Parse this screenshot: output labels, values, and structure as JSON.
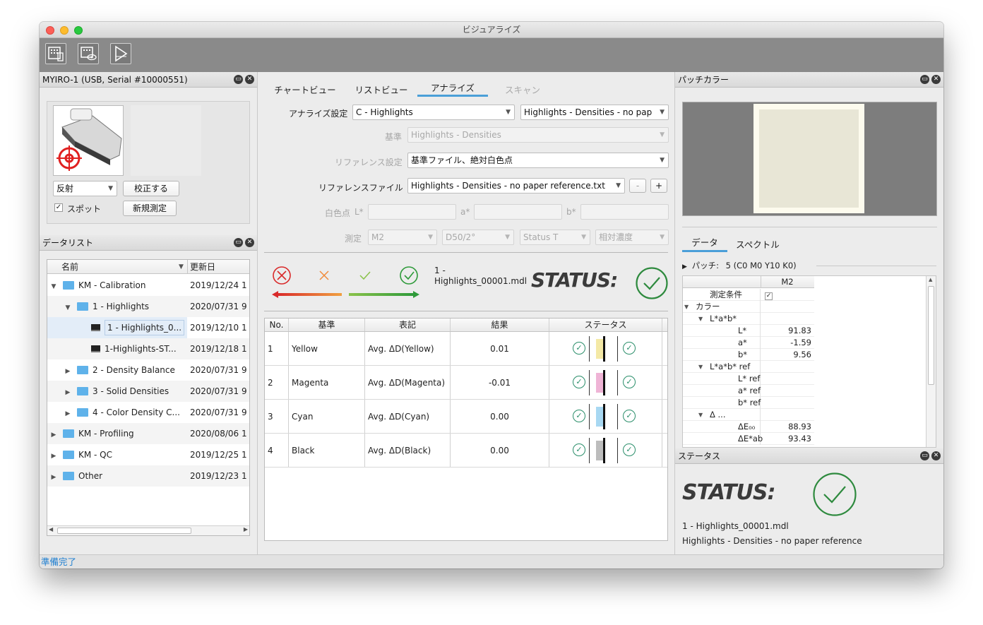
{
  "window": {
    "title": "ビジュアライズ"
  },
  "device_panel": {
    "title": "MYIRO-1 (USB, Serial #10000551)",
    "mode_select": "反射",
    "calibrate_button": "校正する",
    "spot_label": "スポット",
    "spot_checked": true,
    "new_measure_button": "新規測定"
  },
  "datalist": {
    "title": "データリスト",
    "columns": [
      "名前",
      "更新日"
    ],
    "rows": [
      {
        "name": "KM - Calibration",
        "date": "2019/12/24 1",
        "type": "folder",
        "expanded": true,
        "indent": 0
      },
      {
        "name": "1 - Highlights",
        "date": "2020/07/31 9",
        "type": "folder",
        "expanded": true,
        "indent": 1
      },
      {
        "name": "1 - Highlights_0...",
        "date": "2019/12/10 1",
        "type": "doc",
        "indent": 2,
        "selected": true
      },
      {
        "name": "1-Highlights-ST...",
        "date": "2019/12/18 1",
        "type": "doc",
        "indent": 2
      },
      {
        "name": "2 - Density Balance",
        "date": "2020/07/31 9",
        "type": "folder",
        "expanded": false,
        "indent": 1
      },
      {
        "name": "3 - Solid Densities",
        "date": "2020/07/31 9",
        "type": "folder",
        "expanded": false,
        "indent": 1
      },
      {
        "name": "4 - Color Density C...",
        "date": "2020/07/31 9",
        "type": "folder",
        "expanded": false,
        "indent": 1
      },
      {
        "name": "KM - Profiling",
        "date": "2020/08/06 1",
        "type": "folder",
        "expanded": false,
        "indent": 0
      },
      {
        "name": "KM - QC",
        "date": "2019/12/25 1",
        "type": "folder",
        "expanded": false,
        "indent": 0
      },
      {
        "name": "Other",
        "date": "2019/12/23 1",
        "type": "folder",
        "expanded": false,
        "indent": 0
      }
    ]
  },
  "center": {
    "tabs": [
      "チャートビュー",
      "リストビュー",
      "アナライズ",
      "スキャン"
    ],
    "active_tab": "アナライズ",
    "analyze_label": "アナライズ設定",
    "analyze_value": "C - Highlights",
    "analyze_value2": "Highlights - Densities - no pap",
    "criteria_label": "基準",
    "criteria_value": "Highlights - Densities",
    "reference_label": "リファレンス設定",
    "reference_value": "基準ファイル、絶対白色点",
    "reffile_label": "リファレンスファイル",
    "reffile_value": "Highlights - Densities - no paper reference.txt",
    "minus": "-",
    "plus": "+",
    "whitepoint_label": "白色点",
    "L_label": "L*",
    "a_label": "a*",
    "b_label": "b*",
    "measure_label": "測定",
    "measure_m": "M2",
    "measure_d": "D50/2°",
    "measure_status": "Status T",
    "measure_density": "相対濃度",
    "result_file": "1 -\nHighlights_00001.mdl",
    "status_word": "STATUS:",
    "table": {
      "headers": [
        "No.",
        "基準",
        "表記",
        "結果",
        "ステータス"
      ],
      "rows": [
        {
          "no": "1",
          "name": "Yellow",
          "notation": "Avg. ΔD(Yellow)",
          "result": "0.01",
          "color": "#f4e9a6"
        },
        {
          "no": "2",
          "name": "Magenta",
          "notation": "Avg. ΔD(Magenta)",
          "result": "-0.01",
          "color": "#efb4d6"
        },
        {
          "no": "3",
          "name": "Cyan",
          "notation": "Avg. ΔD(Cyan)",
          "result": "0.00",
          "color": "#a8d8f2"
        },
        {
          "no": "4",
          "name": "Black",
          "notation": "Avg. ΔD(Black)",
          "result": "0.00",
          "color": "#bdbdbd"
        }
      ]
    }
  },
  "patch_panel": {
    "title": "パッチカラー",
    "patch_color": "#e8e6d6",
    "tabs": [
      "データ",
      "スペクトル"
    ],
    "patch_label": "パッチ:",
    "patch_value": "5 (C0 M0 Y10 K0)",
    "column": "M2",
    "rows": [
      {
        "k": "測定条件",
        "v": "",
        "indent": 1,
        "check": true
      },
      {
        "k": "カラー",
        "v": "",
        "indent": 0,
        "exp": true
      },
      {
        "k": "L*a*b*",
        "v": "",
        "indent": 1,
        "exp": true
      },
      {
        "k": "L*",
        "v": "91.83",
        "indent": 3
      },
      {
        "k": "a*",
        "v": "-1.59",
        "indent": 3
      },
      {
        "k": "b*",
        "v": "9.56",
        "indent": 3
      },
      {
        "k": "L*a*b* ref",
        "v": "",
        "indent": 1,
        "exp": true
      },
      {
        "k": "L* ref",
        "v": "",
        "indent": 3
      },
      {
        "k": "a* ref",
        "v": "",
        "indent": 3
      },
      {
        "k": "b* ref",
        "v": "",
        "indent": 3
      },
      {
        "k": "Δ ...",
        "v": "",
        "indent": 1,
        "exp": true
      },
      {
        "k": "ΔE₀₀",
        "v": "88.93",
        "indent": 3
      },
      {
        "k": "ΔE*ab",
        "v": "93.43",
        "indent": 3
      }
    ]
  },
  "status_panel": {
    "title": "ステータス",
    "status_word": "STATUS:",
    "file": "1 - Highlights_00001.mdl",
    "reference": "Highlights - Densities - no paper reference"
  },
  "statusbar": {
    "text": "準備完了"
  }
}
